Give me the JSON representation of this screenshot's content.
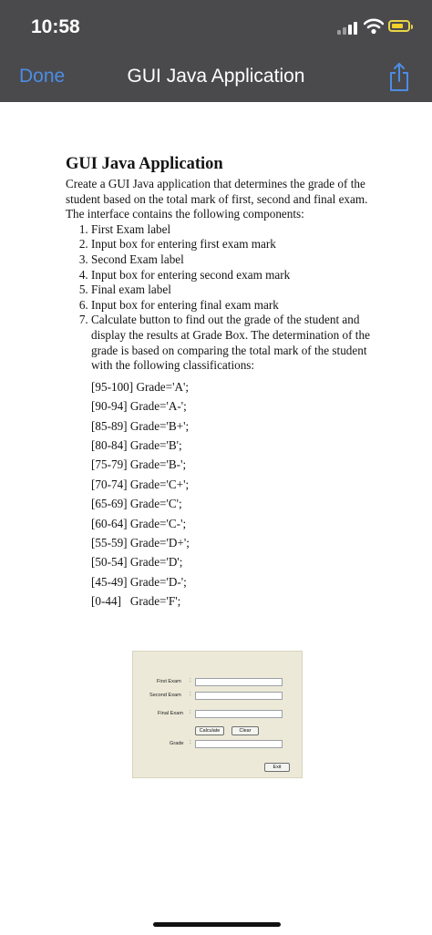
{
  "status_bar": {
    "time": "10:58"
  },
  "nav_bar": {
    "done_label": "Done",
    "title": "GUI Java Application"
  },
  "document": {
    "heading": "GUI Java Application",
    "intro": "Create a GUI Java application that determines the grade of the student based on the total mark of first, second and final exam. The interface contains the following components:",
    "components": [
      "First Exam label",
      "Input box for entering first exam mark",
      "Second Exam label",
      "Input box for entering second exam mark",
      "Final exam label",
      "Input box for entering final exam mark",
      "Calculate button to find out the grade of the student and display the results at Grade Box. The determination of the grade is based on comparing the total mark of the student with the following classifications:"
    ],
    "grades": [
      "[95-100] Grade='A';",
      "[90-94] Grade='A-';",
      "[85-89] Grade='B+';",
      "[80-84] Grade='B';",
      "[75-79] Grade='B-';",
      "[70-74] Grade='C+';",
      "[65-69] Grade='C';",
      "[60-64] Grade='C-';",
      "[55-59] Grade='D+';",
      "[50-54] Grade='D';",
      "[45-49] Grade='D-';",
      "[0-44]   Grade='F';"
    ]
  },
  "form_screenshot": {
    "first_exam_label": "First Exam",
    "second_exam_label": "Second Exam",
    "final_exam_label": "Final Exam",
    "grade_label": "Grade",
    "colon": ":",
    "calculate_label": "Calculate",
    "clear_label": "Clear",
    "exit_label": "Exit"
  },
  "colors": {
    "bar_background": "#4a4a4c",
    "link_blue": "#4c8de6",
    "battery_yellow": "#f2cf2a",
    "form_background": "#ece9d8"
  }
}
